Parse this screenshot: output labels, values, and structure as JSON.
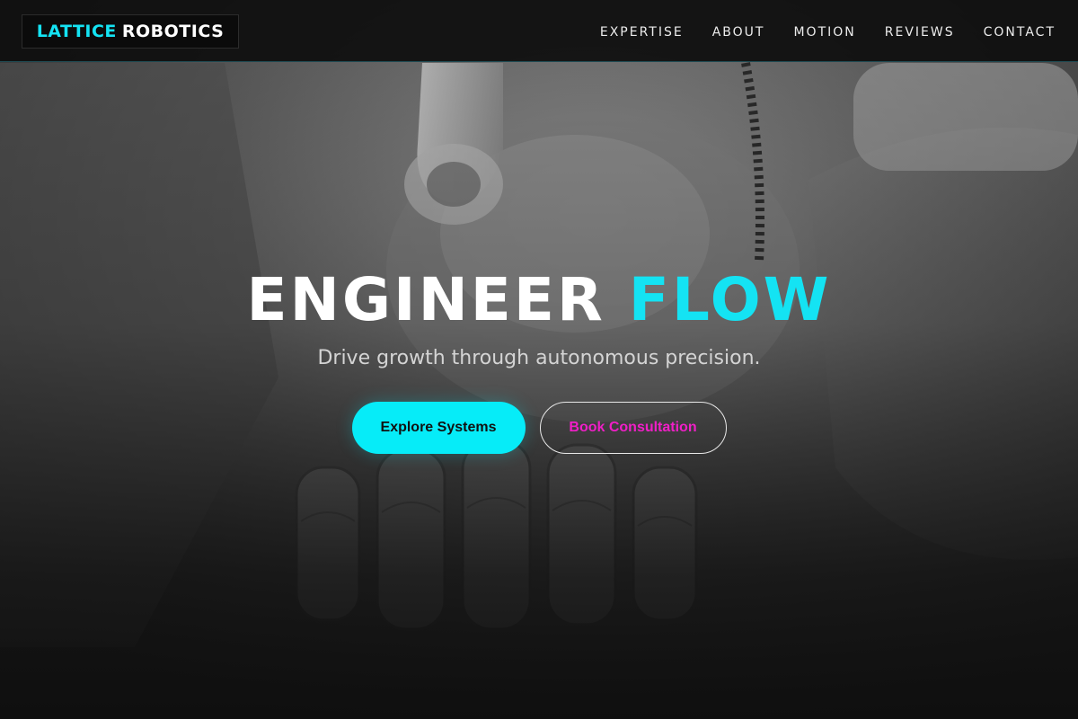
{
  "brand": {
    "accent_word": "LATTICE",
    "main_word": "ROBOTICS",
    "accent_color": "#14e3f3"
  },
  "nav": {
    "items": [
      {
        "label": "EXPERTISE"
      },
      {
        "label": "ABOUT"
      },
      {
        "label": "MOTION"
      },
      {
        "label": "REVIEWS"
      },
      {
        "label": "CONTACT"
      }
    ]
  },
  "hero": {
    "background_image": "robot-hand-photo",
    "title_main": "ENGINEER",
    "title_accent": "FLOW",
    "subtitle": "Drive growth through autonomous precision.",
    "primary_cta": "Explore Systems",
    "secondary_cta": "Book Consultation"
  },
  "colors": {
    "accent_cyan": "#06ecf8",
    "secondary_cta_text": "#f01fc7",
    "background": "#111111"
  }
}
